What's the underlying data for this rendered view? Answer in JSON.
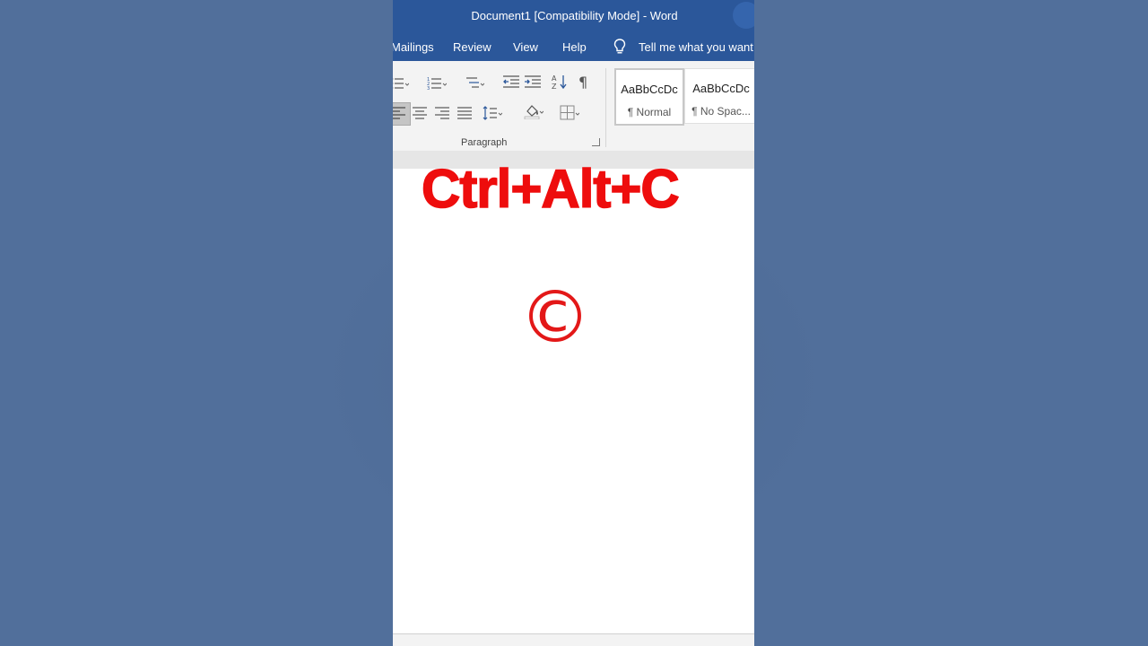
{
  "window": {
    "title": "Document1 [Compatibility Mode]  -  Word"
  },
  "menu": {
    "tabs": [
      "Mailings",
      "Review",
      "View",
      "Help"
    ],
    "tell_me": "Tell me what you want"
  },
  "ribbon": {
    "paragraph_group_label": "Paragraph",
    "icons": [
      "bullets-icon",
      "numbering-icon",
      "multilevel-list-icon",
      "decrease-indent-icon",
      "increase-indent-icon",
      "sort-icon",
      "show-formatting-icon",
      "align-left-icon",
      "align-center-icon",
      "align-right-icon",
      "justify-icon",
      "line-spacing-icon",
      "shading-icon",
      "borders-icon"
    ],
    "styles": [
      {
        "sample": "AaBbCcDc",
        "name": "¶ Normal"
      },
      {
        "sample": "AaBbCcDc",
        "name": "¶ No Spac..."
      }
    ]
  },
  "overlay": {
    "shortcut": "Ctrl+Alt+C",
    "symbol": "©",
    "color": "#ee0d0d"
  },
  "colors": {
    "background": "#516f9b",
    "word_blue": "#2b579a"
  }
}
